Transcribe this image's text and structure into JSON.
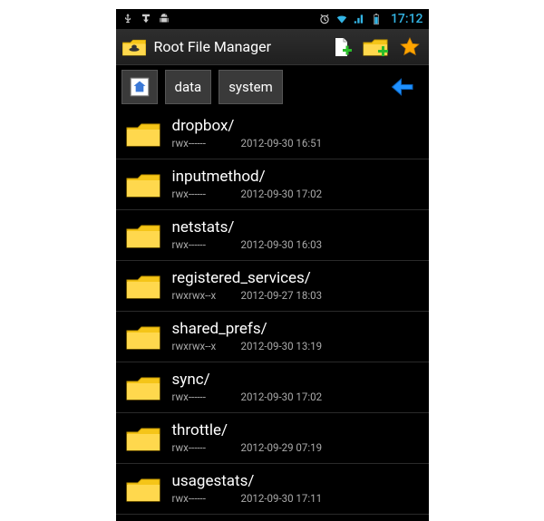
{
  "statusbar": {
    "clock": "17:12"
  },
  "titlebar": {
    "title": "Root File Manager"
  },
  "breadcrumb": {
    "items": [
      {
        "label": "data"
      },
      {
        "label": "system"
      }
    ]
  },
  "files": [
    {
      "name": "dropbox/",
      "perm": "rwx------",
      "date": "2012-09-30 16:51"
    },
    {
      "name": "inputmethod/",
      "perm": "rwx------",
      "date": "2012-09-30 17:02"
    },
    {
      "name": "netstats/",
      "perm": "rwx------",
      "date": "2012-09-30 16:03"
    },
    {
      "name": "registered_services/",
      "perm": "rwxrwx--x",
      "date": "2012-09-27 18:03"
    },
    {
      "name": "shared_prefs/",
      "perm": "rwxrwx--x",
      "date": "2012-09-30 13:19"
    },
    {
      "name": "sync/",
      "perm": "rwx------",
      "date": "2012-09-30 17:02"
    },
    {
      "name": "throttle/",
      "perm": "rwx------",
      "date": "2012-09-29 07:19"
    },
    {
      "name": "usagestats/",
      "perm": "rwx------",
      "date": "2012-09-30 17:11"
    }
  ]
}
